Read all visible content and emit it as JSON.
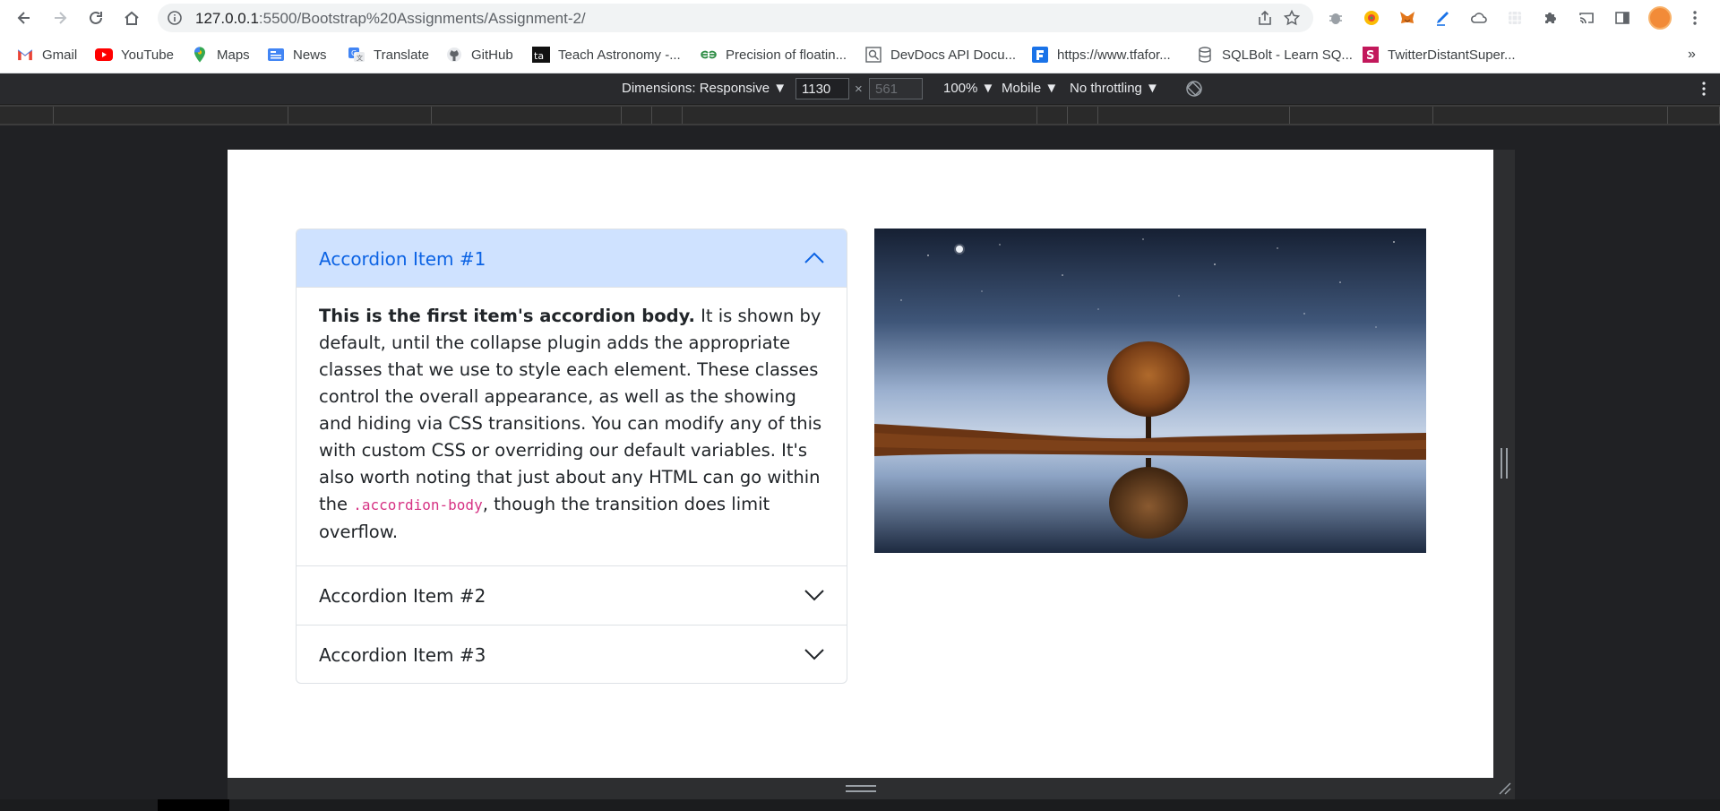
{
  "browser": {
    "url_host": "127.0.0.1",
    "url_path": ":5500/Bootstrap%20Assignments/Assignment-2/"
  },
  "bookmarks": [
    {
      "label": "Gmail",
      "icon": "gmail-icon"
    },
    {
      "label": "YouTube",
      "icon": "youtube-icon"
    },
    {
      "label": "Maps",
      "icon": "maps-icon"
    },
    {
      "label": "News",
      "icon": "news-icon"
    },
    {
      "label": "Translate",
      "icon": "translate-icon"
    },
    {
      "label": "GitHub",
      "icon": "github-icon"
    },
    {
      "label": "Teach Astronomy -...",
      "icon": "ta-icon"
    },
    {
      "label": "Precision of floatin...",
      "icon": "geeksforgeeks-icon"
    },
    {
      "label": "DevDocs API Docu...",
      "icon": "devdocs-icon"
    },
    {
      "label": "https://www.tfafor...",
      "icon": "tfa-icon"
    },
    {
      "label": "SQLBolt - Learn SQ...",
      "icon": "database-icon"
    },
    {
      "label": "TwitterDistantSuper...",
      "icon": "s-icon"
    }
  ],
  "devtools": {
    "dimensions": "Dimensions: Responsive ▼",
    "width": "1130",
    "times": "×",
    "height": "561",
    "zoom": "100% ▼",
    "device": "Mobile ▼",
    "throttle": "No throttling ▼"
  },
  "accordion": {
    "items": [
      {
        "title": "Accordion Item #1",
        "expanded": true
      },
      {
        "title": "Accordion Item #2",
        "expanded": false
      },
      {
        "title": "Accordion Item #3",
        "expanded": false
      }
    ],
    "body_bold": "This is the first item's accordion body.",
    "body_text": " It is shown by default, until the collapse plugin adds the appropriate classes that we use to style each element. These classes control the overall appearance, as well as the showing and hiding via CSS transitions. You can modify any of this with custom CSS or overriding our default variables. It's also worth noting that just about any HTML can go within the ",
    "body_code": ".accordion-body",
    "body_tail": ", though the transition does limit overflow."
  },
  "colors": {
    "accordion_active_bg": "#cfe2ff",
    "accordion_active_text": "#0c63e4",
    "code_color": "#d63384"
  }
}
